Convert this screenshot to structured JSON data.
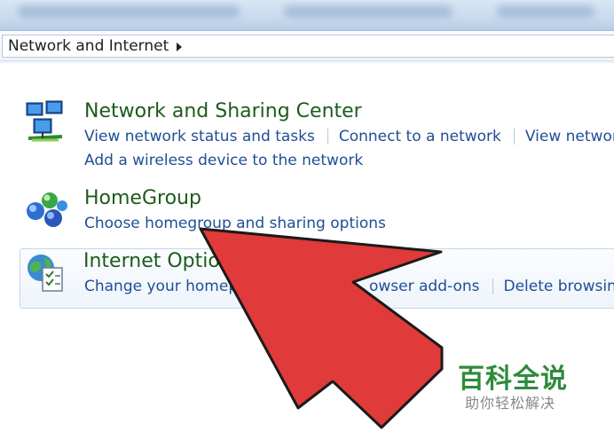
{
  "address_bar": {
    "path": "Network and Internet"
  },
  "categories": [
    {
      "title": "Network and Sharing Center",
      "links_row1": [
        "View network status and tasks",
        "Connect to a network",
        "View network"
      ],
      "links_row2": [
        "Add a wireless device to the network"
      ],
      "icon": "network-computers-icon"
    },
    {
      "title": "HomeGroup",
      "links_row1": [
        "Choose homegroup and sharing options"
      ],
      "icon": "homegroup-icon"
    },
    {
      "title": "Internet Option",
      "links_row1": [
        "Change your homep",
        "owser add-ons",
        "Delete browsin"
      ],
      "icon": "internet-options-icon"
    }
  ],
  "overlay": {
    "arrow_color": "#e03a3a",
    "arrow_icon": "red-pointer-arrow"
  },
  "watermark": {
    "title": "百科全说",
    "subtitle": "助你轻松解决"
  },
  "colors": {
    "category_title": "#1d5b1d",
    "link": "#1f4e95"
  }
}
